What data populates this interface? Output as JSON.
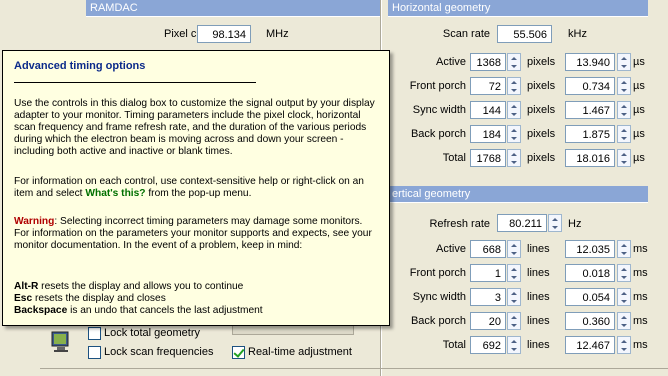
{
  "ramdac": {
    "title": "RAMDAC",
    "pixel_clock_label": "Pixel clock",
    "pixel_clock_value": "98.134",
    "pixel_clock_unit": "MHz"
  },
  "horizontal": {
    "title": "Horizontal geometry",
    "scan_rate_label": "Scan rate",
    "scan_rate_value": "55.506",
    "scan_rate_unit": "kHz",
    "rows": [
      {
        "label": "Active",
        "value": "1368",
        "unit": "pixels",
        "time": "13.940",
        "time_unit": "µs"
      },
      {
        "label": "Front porch",
        "value": "72",
        "unit": "pixels",
        "time": "0.734",
        "time_unit": "µs"
      },
      {
        "label": "Sync width",
        "value": "144",
        "unit": "pixels",
        "time": "1.467",
        "time_unit": "µs"
      },
      {
        "label": "Back porch",
        "value": "184",
        "unit": "pixels",
        "time": "1.875",
        "time_unit": "µs"
      },
      {
        "label": "Total",
        "value": "1768",
        "unit": "pixels",
        "time": "18.016",
        "time_unit": "µs"
      }
    ]
  },
  "vertical": {
    "title": "ertical geometry",
    "refresh_label": "Refresh rate",
    "refresh_value": "80.211",
    "refresh_unit": "Hz",
    "rows": [
      {
        "label": "Active",
        "value": "668",
        "unit": "lines",
        "time": "12.035",
        "time_unit": "ms"
      },
      {
        "label": "Front porch",
        "value": "1",
        "unit": "lines",
        "time": "0.018",
        "time_unit": "ms"
      },
      {
        "label": "Sync width",
        "value": "3",
        "unit": "lines",
        "time": "0.054",
        "time_unit": "ms"
      },
      {
        "label": "Back porch",
        "value": "20",
        "unit": "lines",
        "time": "0.360",
        "time_unit": "ms"
      },
      {
        "label": "Total",
        "value": "692",
        "unit": "lines",
        "time": "12.467",
        "time_unit": "ms"
      }
    ]
  },
  "options": {
    "lock_total_geometry": "Lock total geometry",
    "lock_scan_frequencies": "Lock scan frequencies",
    "realtime_adjustment": "Real-time adjustment",
    "lock_scan_checked": false,
    "realtime_checked": true
  },
  "help": {
    "title": "Advanced timing options",
    "p1": "Use the controls in this dialog box to customize the signal output by your display adapter to your monitor. Timing parameters include the pixel clock, horizontal scan frequency and frame refresh rate, and the duration of the various periods during which the electron beam is moving across and down your screen - including both active and inactive or blank times.",
    "p2_a": "For information on each control, use context-sensitive help or right-click on an item and select ",
    "p2_link": "What's this?",
    "p2_b": " from the pop-up menu.",
    "p3_warn": "Warning",
    "p3": ": Selecting incorrect timing parameters may damage some monitors. For information on the parameters your monitor supports and expects, see your monitor documentation. In the event of a problem, keep in mind:",
    "k1_key": "Alt-R",
    "k1_text": " resets the display and allows you to continue",
    "k2_key": "Esc",
    "k2_text": " resets the display and closes",
    "k3_key": "Backspace",
    "k3_text": " is an undo that cancels the last adjustment"
  },
  "colors": {
    "group_header": "#8aa6d6",
    "tooltip_bg": "#ffffe1",
    "dialog_bg": "#ece9d8"
  }
}
